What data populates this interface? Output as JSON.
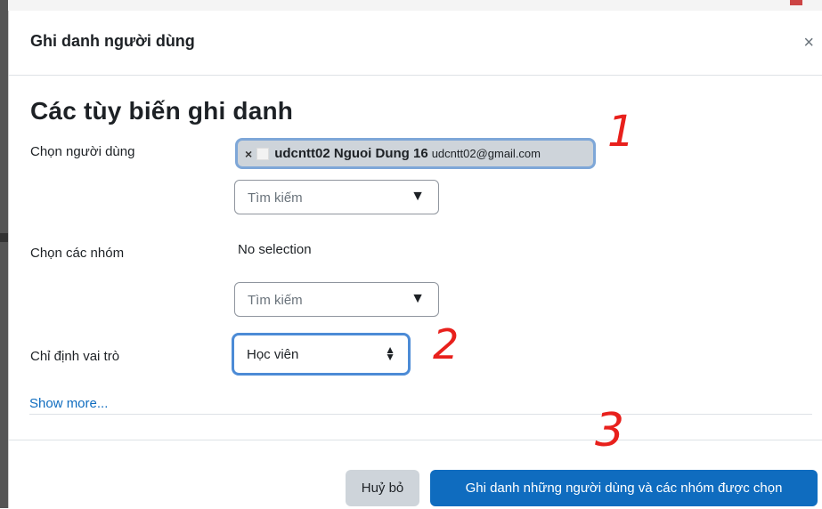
{
  "modal": {
    "title": "Ghi danh người dùng",
    "close_label": "×"
  },
  "form": {
    "section_title": "Các tùy biến ghi danh",
    "select_users": {
      "label": "Chọn người dùng",
      "selected_user": {
        "remove": "×",
        "name": "udcntt02 Nguoi Dung 16",
        "email": "udcntt02@gmail.com"
      },
      "search_placeholder": "Tìm kiếm",
      "search_caret": "▼"
    },
    "select_groups": {
      "label": "Chọn các nhóm",
      "current": "No selection",
      "search_placeholder": "Tìm kiếm",
      "search_caret": "▼"
    },
    "assign_role": {
      "label": "Chỉ định vai trò",
      "value": "Học viên",
      "arrows": "◆"
    },
    "show_more": "Show more..."
  },
  "footer": {
    "cancel_label": "Huỷ bỏ",
    "submit_label": "Ghi danh những người dùng và các nhóm được chọn"
  },
  "annotations": [
    "1",
    "2",
    "3"
  ],
  "colors": {
    "primary": "#0f6cbf",
    "secondary": "#ced4da",
    "annotation": "#e8201c",
    "focus_border": "#4c8bd6"
  }
}
